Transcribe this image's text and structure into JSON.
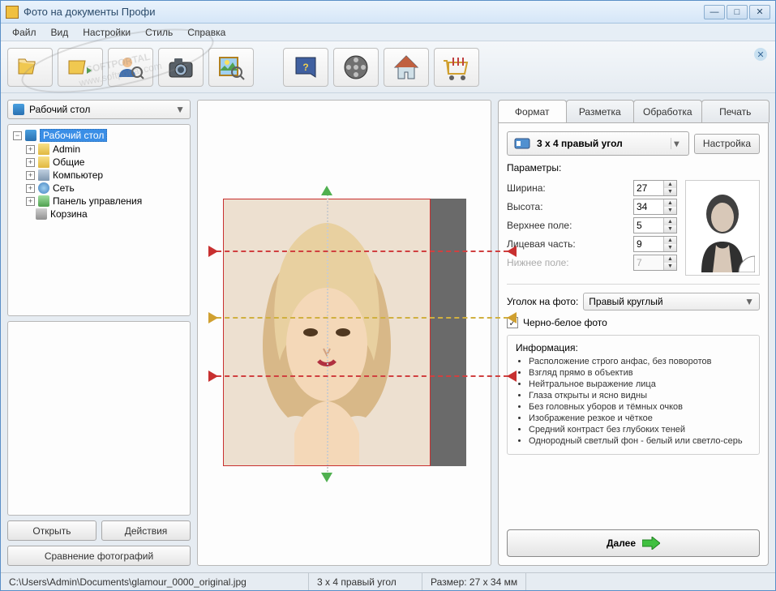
{
  "window": {
    "title": "Фото на документы Профи"
  },
  "menu": {
    "file": "Файл",
    "view": "Вид",
    "settings": "Настройки",
    "style": "Стиль",
    "help": "Справка"
  },
  "toolbar_icons": [
    "folder-open",
    "folder-arrow",
    "user-search",
    "camera",
    "photo-search",
    "help-book",
    "film-reel",
    "home",
    "shopping-cart"
  ],
  "left": {
    "location_combo": "Рабочий стол",
    "tree": {
      "root": "Рабочий стол",
      "children": [
        "Admin",
        "Общие",
        "Компьютер",
        "Сеть",
        "Панель управления",
        "Корзина"
      ]
    },
    "btn_open": "Открыть",
    "btn_actions": "Действия",
    "btn_compare": "Сравнение фотографий"
  },
  "tabs": {
    "format": "Формат",
    "layout": "Разметка",
    "process": "Обработка",
    "print": "Печать"
  },
  "format": {
    "selected": "3 x 4 правый угол",
    "btn_settings": "Настройка",
    "params_label": "Параметры:",
    "width_label": "Ширина:",
    "width": "27",
    "height_label": "Высота:",
    "height": "34",
    "top_label": "Верхнее поле:",
    "top": "5",
    "face_label": "Лицевая часть:",
    "face": "9",
    "bottom_label": "Нижнее поле:",
    "bottom": "7",
    "corner_label": "Уголок на фото:",
    "corner_value": "Правый круглый",
    "bw_label": "Черно-белое фото",
    "info_label": "Информация:",
    "info": [
      "Расположение строго анфас, без поворотов",
      "Взгляд прямо в объектив",
      "Нейтральное выражение лица",
      "Глаза открыты и ясно видны",
      "Без головных уборов и тёмных очков",
      "Изображение резкое и чёткое",
      "Средний контраст без глубоких теней",
      "Однородный светлый фон - белый или светло-серь"
    ],
    "next": "Далее"
  },
  "status": {
    "path": "C:\\Users\\Admin\\Documents\\glamour_0000_original.jpg",
    "format": "3 x 4 правый угол",
    "size": "Размер: 27 x 34 мм"
  },
  "watermark": "SOFTPORTAL"
}
